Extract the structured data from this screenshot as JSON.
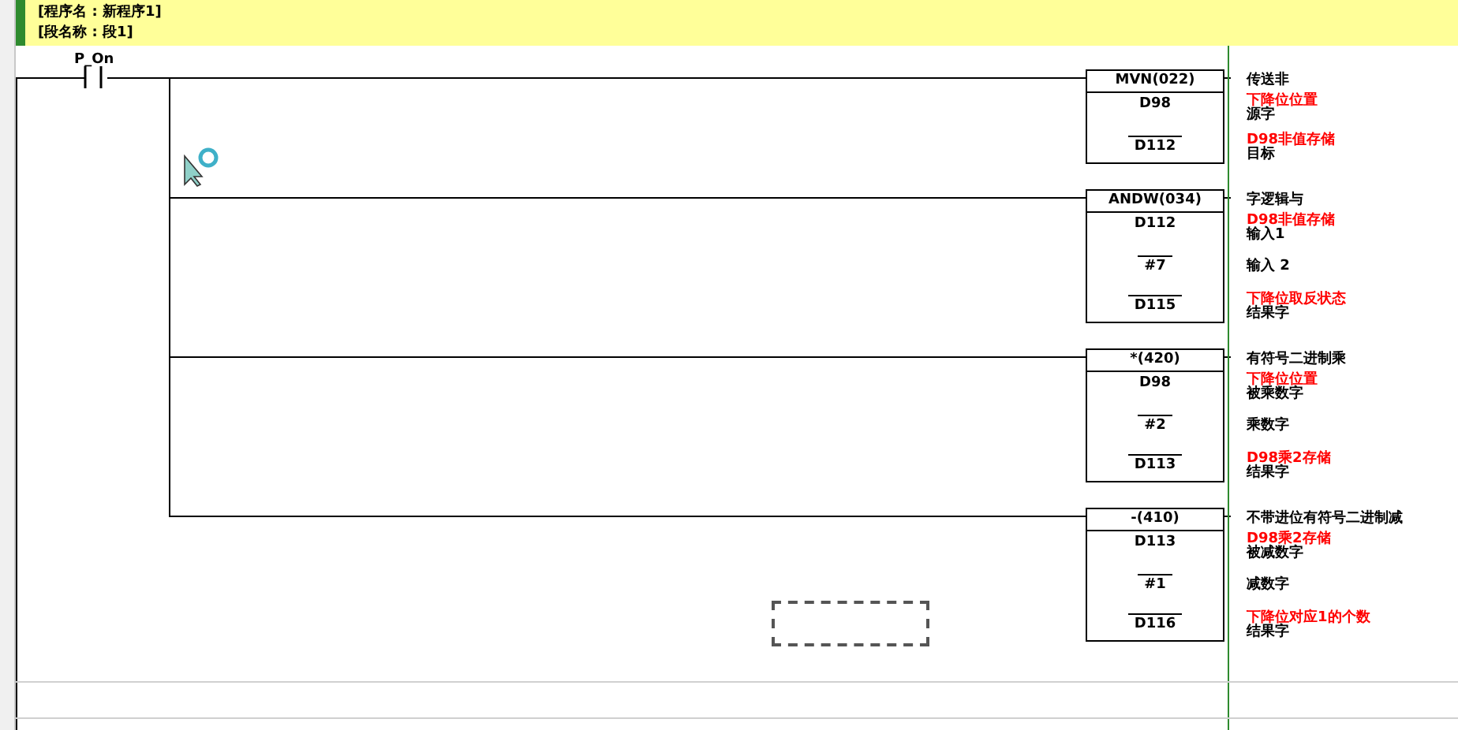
{
  "header": {
    "program": "[程序名 : 新程序1]",
    "section": "[段名称 : 段1]"
  },
  "contact": {
    "label": "P_On"
  },
  "instructions": [
    {
      "mnemonic": "MVN(022)",
      "description": "传送非",
      "operands": [
        {
          "value": "D98",
          "comment": "下降位位置",
          "role": "源字"
        },
        {
          "value": "D112",
          "comment": "D98非值存储",
          "role": "目标"
        }
      ]
    },
    {
      "mnemonic": "ANDW(034)",
      "description": "字逻辑与",
      "operands": [
        {
          "value": "D112",
          "comment": "D98非值存储",
          "role": "输入1"
        },
        {
          "value": "#7",
          "role": "输入 2"
        },
        {
          "value": "D115",
          "comment": "下降位取反状态",
          "role": "结果字"
        }
      ]
    },
    {
      "mnemonic": "*(420)",
      "description": "有符号二进制乘",
      "operands": [
        {
          "value": "D98",
          "comment": "下降位位置",
          "role": "被乘数字"
        },
        {
          "value": "#2",
          "role": "乘数字"
        },
        {
          "value": "D113",
          "comment": "D98乘2存储",
          "role": "结果字"
        }
      ]
    },
    {
      "mnemonic": "-(410)",
      "description": "不带进位有符号二进制减",
      "operands": [
        {
          "value": "D113",
          "comment": "D98乘2存储",
          "role": "被减数字"
        },
        {
          "value": "#1",
          "role": "减数字"
        },
        {
          "value": "D116",
          "comment": "下降位对应1的个数",
          "role": "结果字"
        }
      ]
    }
  ]
}
